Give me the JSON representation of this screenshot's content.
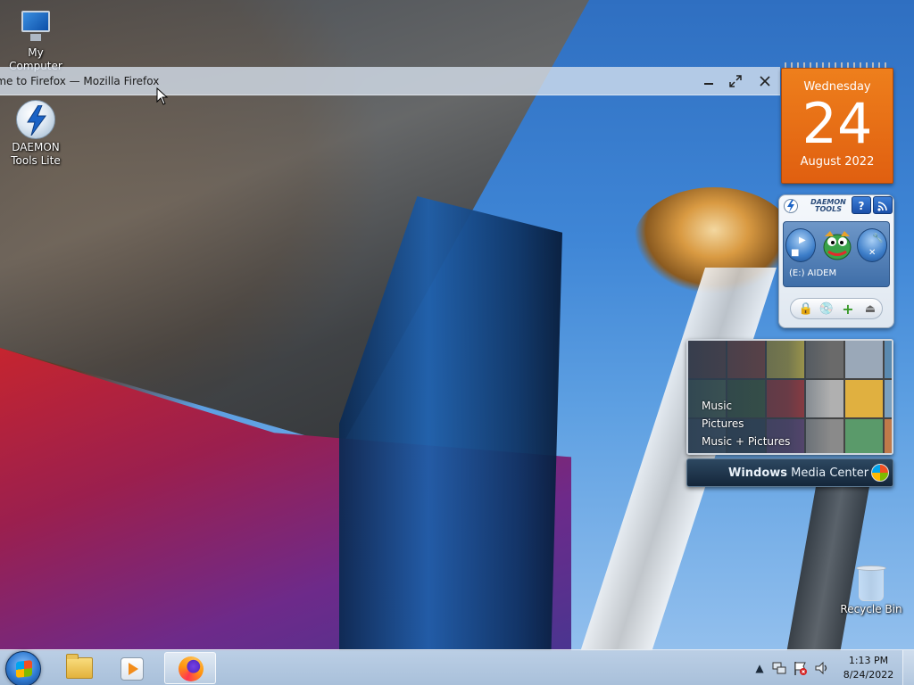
{
  "desktop": {
    "icons": [
      {
        "label": "My Computer"
      },
      {
        "label": "DAEMON\nTools Lite"
      },
      {
        "label": "Recycle Bin"
      }
    ]
  },
  "firefox_window": {
    "title": "ome to Firefox — Mozilla Firefox",
    "minimize_icon": "minimize-icon",
    "restore_icon": "restore-icon",
    "close_icon": "close-icon"
  },
  "calendar_gadget": {
    "weekday": "Wednesday",
    "day": "24",
    "month_year": "August 2022",
    "color": "#e8701a"
  },
  "daemon_gadget": {
    "brand_line1": "DAEMON",
    "brand_line2": "TOOLS",
    "help_label": "?",
    "drive_label": "(E:) AIDEM",
    "icons": [
      "lock-icon",
      "mount-icon",
      "add-icon",
      "unmount-icon"
    ]
  },
  "media_center_gadget": {
    "menu": [
      "Music",
      "Pictures",
      "Music + Pictures"
    ],
    "brand_bold": "Windows",
    "brand_rest": " Media Center"
  },
  "taskbar": {
    "pinned": [
      "windows-explorer",
      "windows-media-player",
      "firefox"
    ],
    "active": "firefox",
    "clock_time": "1:13 PM",
    "clock_date": "8/24/2022"
  },
  "colors": {
    "accent": "#2f7ad1",
    "calendar_orange": "#e8701a"
  }
}
